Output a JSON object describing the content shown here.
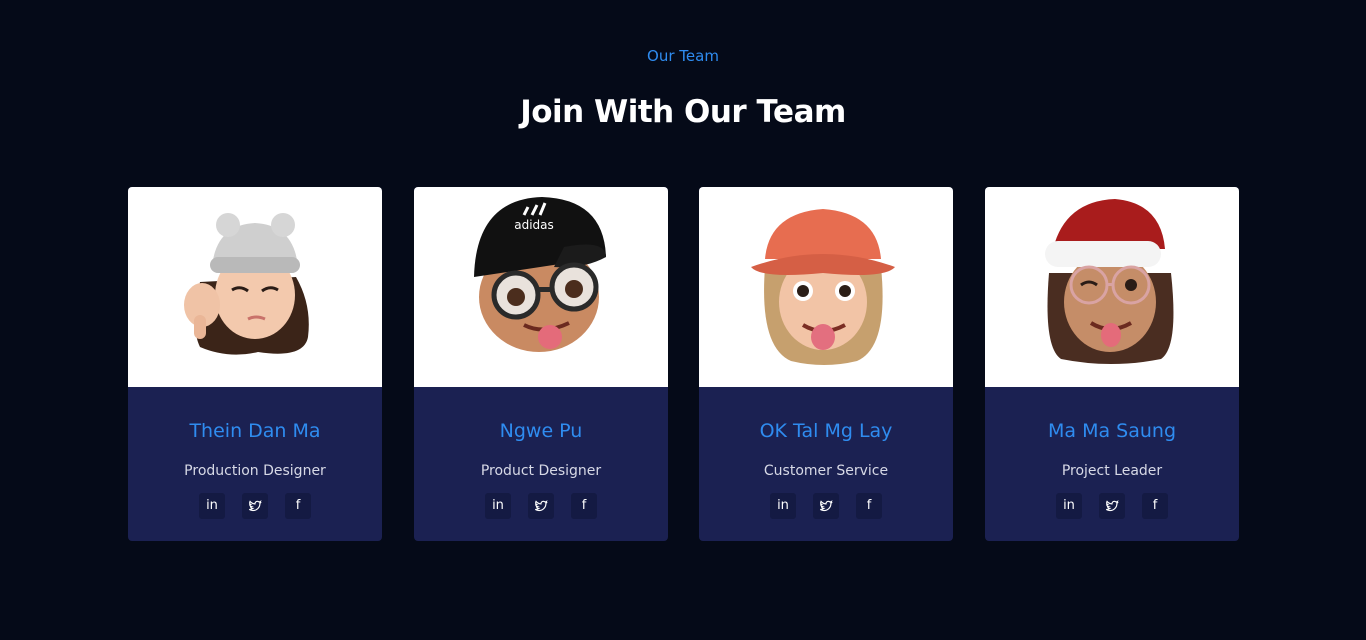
{
  "header": {
    "eyebrow": "Our Team",
    "title": "Join With Our Team"
  },
  "colors": {
    "background": "#050a18",
    "accent": "#2f8cf0",
    "card": "#1b2152",
    "social_bg": "#141a43"
  },
  "team": [
    {
      "name": "Thein Dan Ma",
      "role": "Production Designer",
      "avatar": "memoji-girl-gray-beanie-thumbs-down"
    },
    {
      "name": "Ngwe Pu",
      "role": "Product Designer",
      "avatar": "memoji-boy-black-cap-glasses",
      "cap_text": "adidas"
    },
    {
      "name": "OK Tal Mg Lay",
      "role": "Customer Service",
      "avatar": "memoji-girl-orange-bucket-hat"
    },
    {
      "name": "Ma Ma Saung",
      "role": "Project Leader",
      "avatar": "memoji-girl-santa-hat-glasses"
    }
  ],
  "socials": [
    {
      "label": "in",
      "icon": "linkedin-icon"
    },
    {
      "label": "",
      "icon": "twitter-icon"
    },
    {
      "label": "f",
      "icon": "facebook-icon"
    }
  ]
}
